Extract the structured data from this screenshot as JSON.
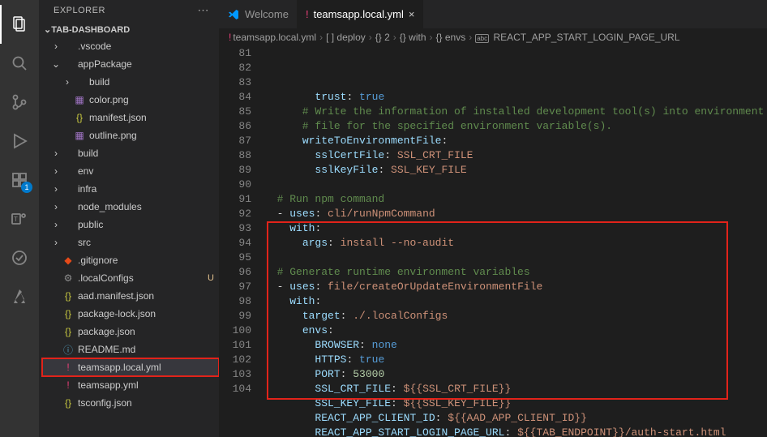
{
  "sidebar": {
    "title": "EXPLORER",
    "section": "TAB-DASHBOARD",
    "items": [
      {
        "label": ".vscode",
        "type": "folder",
        "ind": 0,
        "open": false
      },
      {
        "label": "appPackage",
        "type": "folder",
        "ind": 0,
        "open": true
      },
      {
        "label": "build",
        "type": "folder",
        "ind": 1,
        "open": false
      },
      {
        "label": "color.png",
        "type": "img",
        "ind": 1
      },
      {
        "label": "manifest.json",
        "type": "json",
        "ind": 1
      },
      {
        "label": "outline.png",
        "type": "img",
        "ind": 1
      },
      {
        "label": "build",
        "type": "folder",
        "ind": 0,
        "open": false
      },
      {
        "label": "env",
        "type": "folder",
        "ind": 0,
        "open": false
      },
      {
        "label": "infra",
        "type": "folder",
        "ind": 0,
        "open": false
      },
      {
        "label": "node_modules",
        "type": "folder",
        "ind": 0,
        "open": false
      },
      {
        "label": "public",
        "type": "folder",
        "ind": 0,
        "open": false
      },
      {
        "label": "src",
        "type": "folder",
        "ind": 0,
        "open": false
      },
      {
        "label": ".gitignore",
        "type": "git",
        "ind": 0
      },
      {
        "label": ".localConfigs",
        "type": "cfg",
        "ind": 0,
        "mod": true
      },
      {
        "label": "aad.manifest.json",
        "type": "json",
        "ind": 0
      },
      {
        "label": "package-lock.json",
        "type": "json",
        "ind": 0
      },
      {
        "label": "package.json",
        "type": "json",
        "ind": 0
      },
      {
        "label": "README.md",
        "type": "md",
        "ind": 0
      },
      {
        "label": "teamsapp.local.yml",
        "type": "yml",
        "ind": 0,
        "sel": true
      },
      {
        "label": "teamsapp.yml",
        "type": "yml",
        "ind": 0
      },
      {
        "label": "tsconfig.json",
        "type": "json",
        "ind": 0
      }
    ]
  },
  "tabs": [
    {
      "label": "Welcome",
      "icon": "vscode",
      "active": false
    },
    {
      "label": "teamsapp.local.yml",
      "icon": "yml",
      "active": true,
      "close": true
    }
  ],
  "breadcrumb": [
    "teamsapp.local.yml",
    "[ ] deploy",
    "{} 2",
    "{} with",
    "{} envs",
    "REACT_APP_START_LOGIN_PAGE_URL"
  ],
  "bc_icons": [
    "!",
    "",
    "",
    "",
    "",
    "abc"
  ],
  "code": {
    "start": 81,
    "lines": [
      "        trust: true",
      "      # Write the information of installed development tool(s) into environment",
      "      # file for the specified environment variable(s).",
      "      writeToEnvironmentFile:",
      "        sslCertFile: SSL_CRT_FILE",
      "        sslKeyFile: SSL_KEY_FILE",
      "",
      "  # Run npm command",
      "  - uses: cli/runNpmCommand",
      "    with:",
      "      args: install --no-audit",
      "",
      "  # Generate runtime environment variables",
      "  - uses: file/createOrUpdateEnvironmentFile",
      "    with:",
      "      target: ./.localConfigs",
      "      envs:",
      "        BROWSER: none",
      "        HTTPS: true",
      "        PORT: 53000",
      "        SSL_CRT_FILE: ${{SSL_CRT_FILE}}",
      "        SSL_KEY_FILE: ${{SSL_KEY_FILE}}",
      "        REACT_APP_CLIENT_ID: ${{AAD_APP_CLIENT_ID}}",
      "        REACT_APP_START_LOGIN_PAGE_URL: ${{TAB_ENDPOINT}}/auth-start.html"
    ]
  },
  "badge": "1"
}
